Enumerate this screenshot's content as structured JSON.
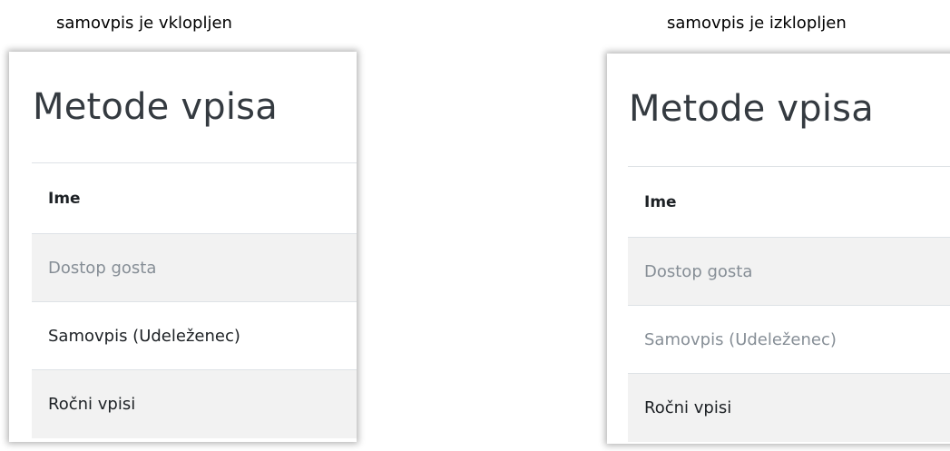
{
  "captions": {
    "left": "samovpis je vklopljen",
    "right": "samovpis je izklopljen"
  },
  "panels": [
    {
      "heading": "Metode vpisa",
      "column_header": "Ime",
      "rows": [
        {
          "label": "Dostop gosta",
          "state": "disabled"
        },
        {
          "label": "Samovpis (Udeleženec)",
          "state": "enabled"
        },
        {
          "label": "Ročni vpisi",
          "state": "enabled"
        }
      ]
    },
    {
      "heading": "Metode vpisa",
      "column_header": "Ime",
      "rows": [
        {
          "label": "Dostop gosta",
          "state": "disabled"
        },
        {
          "label": "Samovpis (Udeleženec)",
          "state": "disabled"
        },
        {
          "label": "Ročni vpisi",
          "state": "enabled"
        }
      ]
    }
  ],
  "colors": {
    "text_enabled": "#1d2125",
    "text_disabled": "#868e96",
    "row_stripe": "#f2f2f2",
    "border": "#dee2e6"
  }
}
